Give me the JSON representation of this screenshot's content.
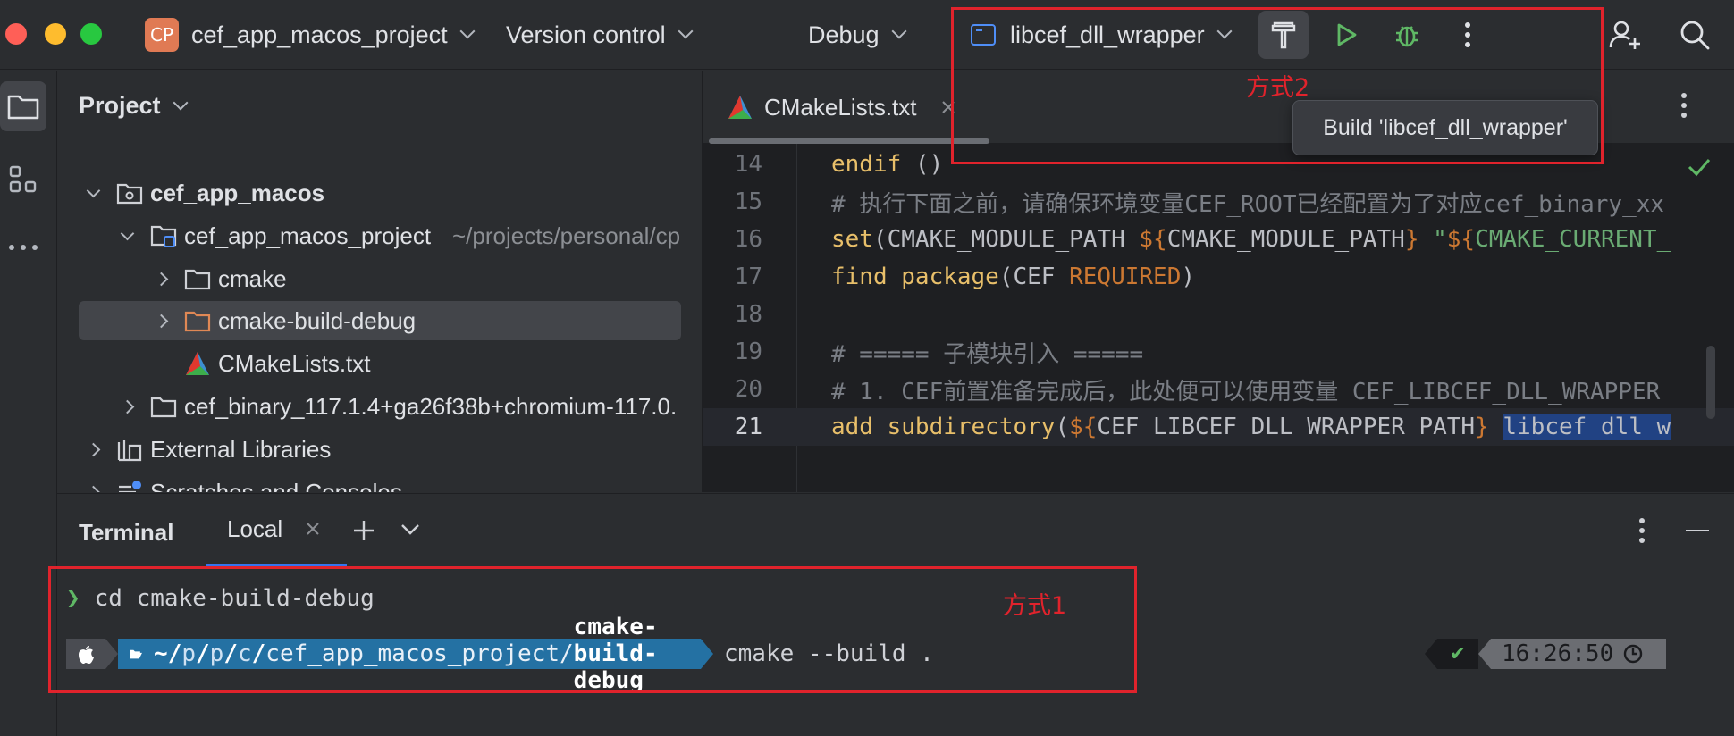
{
  "titlebar": {
    "project_badge": "CP",
    "project_name": "cef_app_macos_project",
    "vcs_label": "Version control",
    "config_label": "Debug",
    "run_target": "libcef_dll_wrapper",
    "icons": [
      "hammer-icon",
      "run-icon",
      "debug-icon",
      "more-vertical-icon",
      "add-user-icon",
      "search-icon"
    ]
  },
  "project_panel": {
    "title": "Project",
    "tree": [
      {
        "label": "cef_app_macos",
        "icon": "module-folder",
        "expanded": true
      },
      {
        "label": "cef_app_macos_project",
        "path_hint": "~/projects/personal/cp",
        "icon": "folder",
        "expanded": true
      },
      {
        "label": "cmake",
        "icon": "folder",
        "expanded": false
      },
      {
        "label": "cmake-build-debug",
        "icon": "folder-orange",
        "expanded": false,
        "selected": true
      },
      {
        "label": "CMakeLists.txt",
        "icon": "cmake-file"
      },
      {
        "label": "cef_binary_117.1.4+ga26f38b+chromium-117.0.",
        "icon": "folder",
        "expanded": false
      },
      {
        "label": "External Libraries",
        "icon": "library"
      },
      {
        "label": "Scratches and Consoles",
        "icon": "scratches"
      }
    ]
  },
  "editor": {
    "tab_label": "CMakeLists.txt",
    "lines": [
      {
        "n": "14"
      },
      {
        "n": "15"
      },
      {
        "n": "16"
      },
      {
        "n": "17"
      },
      {
        "n": "18"
      },
      {
        "n": "19"
      },
      {
        "n": "20"
      },
      {
        "n": "21"
      }
    ],
    "code": {
      "l14_kw": "endif",
      "l14_rest": " ()",
      "l15": "# 执行下面之前，请确保环境变量CEF_ROOT已经配置为了对应cef_binary_xx",
      "l16_kw": "set",
      "l16_a": "(CMAKE_MODULE_PATH ",
      "l16_b": "${",
      "l16_c": "CMAKE_MODULE_PATH",
      "l16_d": "}",
      "l16_e": " \"",
      "l16_f": "${",
      "l16_g": "CMAKE_CURRENT_",
      "l17_kw": "find_package",
      "l17_a": "(CEF ",
      "l17_b": "REQUIRED",
      "l17_c": ")",
      "l19": "# ===== 子模块引入 =====",
      "l20": "# 1. CEF前置准备完成后，此处便可以使用变量 CEF_LIBCEF_DLL_WRAPPER",
      "l21_kw": "add_subdirectory",
      "l21_a": "(",
      "l21_b": "${",
      "l21_c": "CEF_LIBCEF_DLL_WRAPPER_PATH",
      "l21_d": "}",
      "l21_e": " ",
      "l21_sel": "libcef_dll_w"
    }
  },
  "tooltip": "Build 'libcef_dll_wrapper'",
  "terminal": {
    "title": "Terminal",
    "tab_label": "Local",
    "prompt_arrow": "❯",
    "line1": "cd cmake-build-debug",
    "path_prefix": "~/",
    "path_p1": "p",
    "path_p2": "p",
    "path_c": "c",
    "path_project": "cef_app_macos_project/",
    "path_dir": "cmake-build-debug",
    "command": "cmake --build .",
    "status_check": "✔",
    "time": "16:26:50"
  },
  "annotations": {
    "method1": "方式1",
    "method2": "方式2"
  },
  "colors": {
    "accent_blue": "#3574f0",
    "annotation_red": "#e0232c",
    "run_green": "#5fb865",
    "keyword": "#e8bf6a",
    "variable": "#cc7832",
    "string": "#6aab73"
  }
}
